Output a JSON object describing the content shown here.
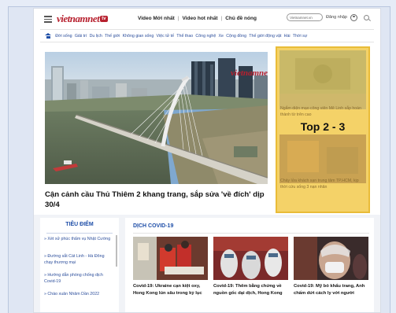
{
  "header": {
    "logo_main": "vietnamnet",
    "logo_badge": "tv",
    "nav": [
      "Video Mới nhất",
      "Video hot nhất",
      "Chủ đề nóng"
    ],
    "search_placeholder": "Vietnamnet.vn",
    "login_label": "Đăng nhập"
  },
  "categories": [
    "Đời sống",
    "Giải trí",
    "Du lịch",
    "Thế giới",
    "Không gian sống",
    "Việc tử tế",
    "Thể thao",
    "Công nghệ",
    "Xe",
    "Cộng đồng",
    "Thế giới động vật",
    "Hài",
    "Thời sự"
  ],
  "hero": {
    "image_logo": "vietnamnet",
    "title": "Cận cảnh cầu Thủ Thiêm 2 khang trang, sắp sửa 'về đích' dịp 30/4"
  },
  "side": {
    "caption_1": "Ngắm diện mạo công viên Mê Linh sắp hoàn thành từ trên cao",
    "label": "Top 2 - 3",
    "caption_2": "Chảy lửa khách sạn trung tâm TP.HCM, kịp thời cứu sống 3 nạn nhân"
  },
  "tieudiem": {
    "title": "TIÊU ĐIỂM",
    "items": [
      "Xét xử phúc thẩm vụ Nhật Cường",
      "Đường sắt Cát Linh - Hà Đông chạy thương mại",
      "Hướng dẫn phòng chống dịch Covid-19",
      "Chào xuân Nhâm Dần 2022"
    ]
  },
  "covid": {
    "title": "DỊCH COVID-19",
    "cards": [
      {
        "caption": "Covid-19: Ukraine cạn kiệt oxy, Hong Kong lún sâu trong kỷ lục"
      },
      {
        "caption": "Covid-19: Thêm bằng chứng về nguồn gốc dại dịch, Hong Kong"
      },
      {
        "caption": "Covid-19: Mỹ bỏ khẩu trang, Anh chấm dứt cách ly với người"
      }
    ]
  },
  "colors": {
    "brand_red": "#b7202e",
    "link_blue": "#1f4fa8",
    "highlight_yellow": "#f4d268"
  }
}
